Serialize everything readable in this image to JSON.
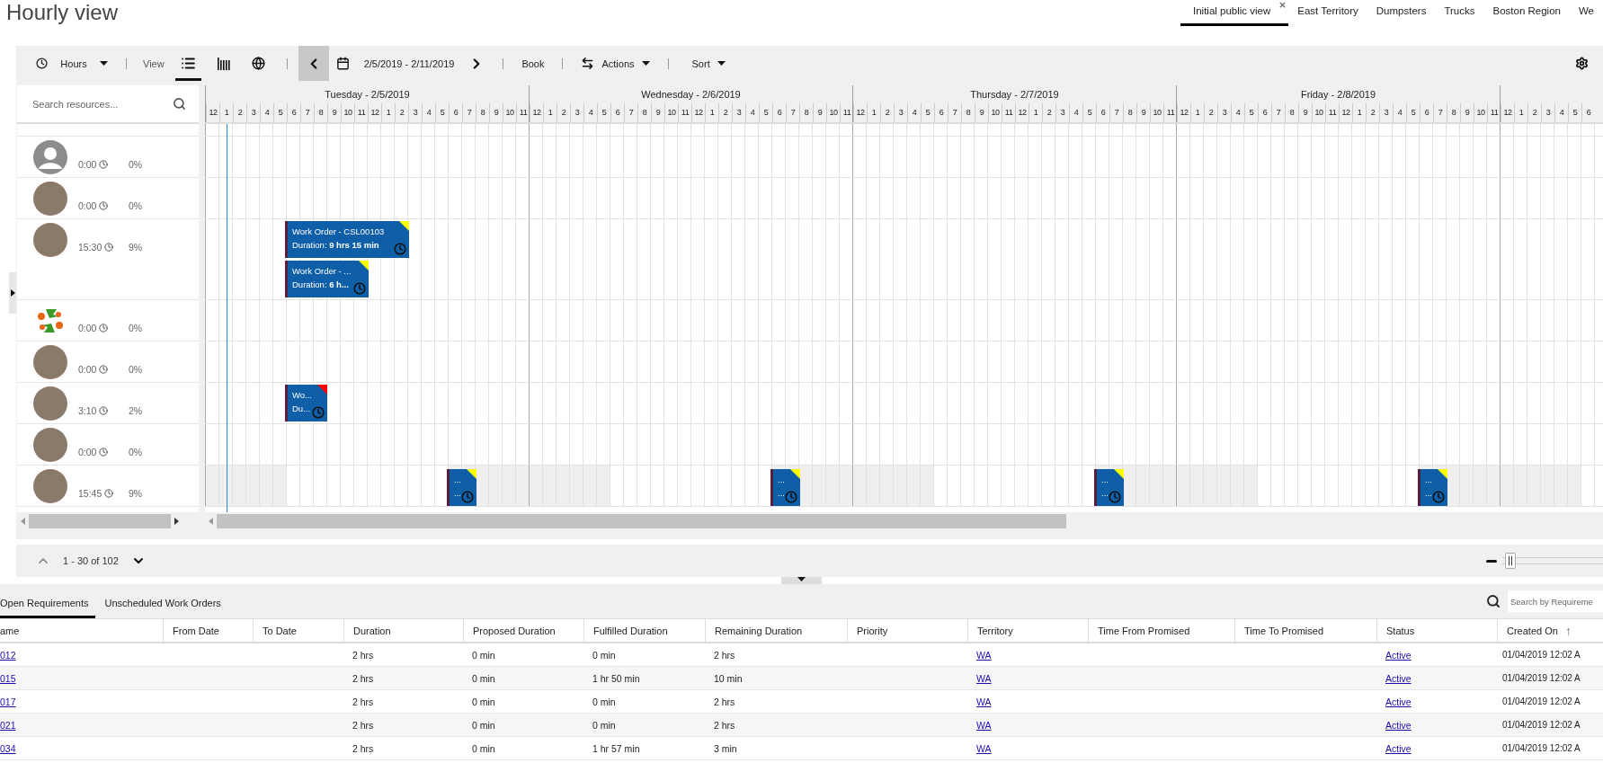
{
  "header": {
    "title": "Hourly view"
  },
  "view_tabs": [
    {
      "label": "Initial public view",
      "selected": true,
      "closable": true
    },
    {
      "label": "East Territory",
      "selected": false,
      "closable": false
    },
    {
      "label": "Dumpsters",
      "selected": false,
      "closable": false
    },
    {
      "label": "Trucks",
      "selected": false,
      "closable": false
    },
    {
      "label": "Boston Region",
      "selected": false,
      "closable": false
    },
    {
      "label": "We",
      "selected": false,
      "closable": false
    }
  ],
  "toolbar": {
    "time_scale": "Hours",
    "view_label": "View",
    "view_modes": [
      {
        "kind": "list",
        "selected": true
      },
      {
        "kind": "columns",
        "selected": false
      },
      {
        "kind": "map",
        "selected": false
      }
    ],
    "date_range": "2/5/2019 - 2/11/2019",
    "book": "Book",
    "actions": "Actions",
    "sort": "Sort"
  },
  "resource_search": {
    "placeholder": "Search resources..."
  },
  "days": [
    {
      "label": "Tuesday - 2/5/2019",
      "hours": [
        "12",
        "1",
        "2",
        "3",
        "4",
        "5",
        "6",
        "7",
        "8",
        "9",
        "10",
        "11",
        "12",
        "1",
        "2",
        "3",
        "4",
        "5",
        "6",
        "7",
        "8",
        "9",
        "10",
        "11"
      ]
    },
    {
      "label": "Wednesday - 2/6/2019",
      "hours": [
        "12",
        "1",
        "2",
        "3",
        "4",
        "5",
        "6",
        "7",
        "8",
        "9",
        "10",
        "11",
        "12",
        "1",
        "2",
        "3",
        "4",
        "5",
        "6",
        "7",
        "8",
        "9",
        "10",
        "11"
      ]
    },
    {
      "label": "Thursday - 2/7/2019",
      "hours": [
        "12",
        "1",
        "2",
        "3",
        "4",
        "5",
        "6",
        "7",
        "8",
        "9",
        "10",
        "11",
        "12",
        "1",
        "2",
        "3",
        "4",
        "5",
        "6",
        "7",
        "8",
        "9",
        "10",
        "11"
      ]
    },
    {
      "label": "Friday - 2/8/2019",
      "hours": [
        "12",
        "1",
        "2",
        "3",
        "4",
        "5",
        "6",
        "7",
        "8",
        "9",
        "10",
        "11",
        "12",
        "1",
        "2",
        "3",
        "4",
        "5",
        "6",
        "7",
        "8",
        "9",
        "10",
        "11"
      ]
    },
    {
      "hours": [
        "12",
        "1",
        "2",
        "3",
        "4",
        "5",
        "6"
      ]
    }
  ],
  "resources": [
    {
      "kind": "generic",
      "time": "0:00",
      "utilization": "0%",
      "off_hours_shaded": false
    },
    {
      "kind": "photo",
      "time": "0:00",
      "utilization": "0%",
      "off_hours_shaded": false
    },
    {
      "kind": "photo",
      "time": "15:30",
      "utilization": "9%",
      "off_hours_shaded": false,
      "bookings": [
        {
          "title": "Work Order - CSL00103",
          "detail": "Duration: **9 hrs 15 min**",
          "color": "#ffff00"
        },
        {
          "title": "Work Order - ...",
          "detail": "Duration: **6 h...**",
          "color": "#ffff00"
        }
      ]
    },
    {
      "kind": "logo",
      "time": "0:00",
      "utilization": "0%",
      "off_hours_shaded": false
    },
    {
      "kind": "photo",
      "time": "0:00",
      "utilization": "0%",
      "off_hours_shaded": false
    },
    {
      "kind": "photo",
      "time": "3:10",
      "utilization": "2%",
      "off_hours_shaded": false,
      "bookings": [
        {
          "title": "Wo...",
          "detail": "Du...",
          "color": "#ff0000"
        }
      ]
    },
    {
      "kind": "photo",
      "time": "0:00",
      "utilization": "0%",
      "off_hours_shaded": false
    },
    {
      "kind": "photo",
      "time": "15:45",
      "utilization": "9%",
      "off_hours_shaded": true,
      "bookings": [
        {
          "title": "...",
          "detail": "...",
          "color": "#ffff00"
        },
        {
          "title": "...",
          "detail": "...",
          "color": "#ffff00"
        },
        {
          "title": "...",
          "detail": "...",
          "color": "#ffff00"
        },
        {
          "title": "...",
          "detail": "...",
          "color": "#ffff00"
        }
      ]
    }
  ],
  "pagination": {
    "range": "1 - 30 of 102"
  },
  "zoom_slider": {
    "level": 0.03
  },
  "requirements": {
    "tabs": [
      {
        "label": "Open Requirements",
        "selected": true
      },
      {
        "label": "Unscheduled Work Orders",
        "selected": false
      }
    ],
    "search": {
      "placeholder": "Search by Requireme"
    },
    "columns": [
      {
        "label": "ame"
      },
      {
        "label": "From Date"
      },
      {
        "label": "To Date"
      },
      {
        "label": "Duration"
      },
      {
        "label": "Proposed Duration"
      },
      {
        "label": "Fulfilled Duration"
      },
      {
        "label": "Remaining Duration"
      },
      {
        "label": "Priority"
      },
      {
        "label": "Territory"
      },
      {
        "label": "Time From Promised"
      },
      {
        "label": "Time To Promised"
      },
      {
        "label": "Status"
      },
      {
        "label": "Created On",
        "sort_indicator": "↑"
      }
    ],
    "rows": [
      [
        "012",
        "",
        "",
        "2 hrs",
        "0 min",
        "0 min",
        "2 hrs",
        "",
        "WA",
        "",
        "",
        "Active",
        "01/04/2019 12:02 A"
      ],
      [
        "015",
        "",
        "",
        "2 hrs",
        "0 min",
        "1 hr 50 min",
        "10 min",
        "",
        "WA",
        "",
        "",
        "Active",
        "01/04/2019 12:02 A"
      ],
      [
        "017",
        "",
        "",
        "2 hrs",
        "0 min",
        "0 min",
        "2 hrs",
        "",
        "WA",
        "",
        "",
        "Active",
        "01/04/2019 12:02 A"
      ],
      [
        "021",
        "",
        "",
        "2 hrs",
        "0 min",
        "0 min",
        "2 hrs",
        "",
        "WA",
        "",
        "",
        "Active",
        "01/04/2019 12:02 A"
      ],
      [
        "034",
        "",
        "",
        "2 hrs",
        "0 min",
        "1 hr 57 min",
        "3 min",
        "",
        "WA",
        "",
        "",
        "Active",
        "01/04/2019 12:02 A"
      ]
    ]
  }
}
